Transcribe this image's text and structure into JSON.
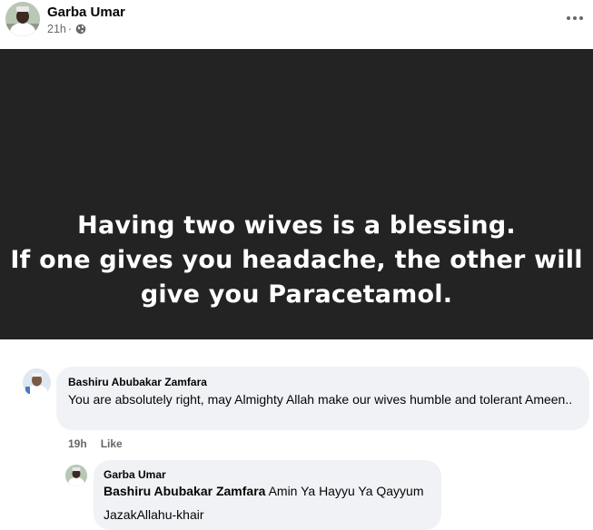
{
  "post": {
    "author": "Garba Umar",
    "time": "21h",
    "separator": "·",
    "audience_icon": "globe-icon",
    "more_icon": "more-options-icon",
    "image_text": {
      "line1": "Having two wives is a blessing.",
      "line2": "If one gives you headache, the other will",
      "line3": "give you Paracetamol."
    },
    "image_background": "#232323"
  },
  "comment": {
    "author": "Bashiru Abubakar Zamfara",
    "text": "You are absolutely right, may Almighty Allah make our wives humble and tolerant Ameen..",
    "time": "19h",
    "like_label": "Like"
  },
  "reply": {
    "author": "Garba Umar",
    "mention": "Bashiru Abubakar Zamfara",
    "text": "Amin Ya Hayyu Ya Qayyum",
    "text2": "JazakAllahu-khair"
  },
  "colors": {
    "bubble": "#f0f2f5",
    "secondary_text": "#65676b",
    "primary_text": "#050505"
  }
}
